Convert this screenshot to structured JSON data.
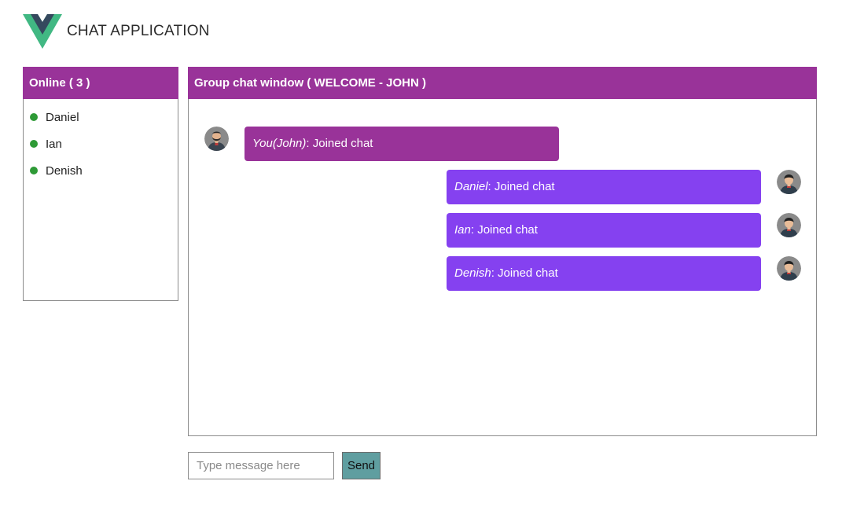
{
  "header": {
    "logo_icon": "vue-logo",
    "title": "CHAT APPLICATION"
  },
  "online": {
    "title": "Online ( 3 )",
    "status_color": "#2e9a36",
    "users": [
      {
        "name": "Daniel"
      },
      {
        "name": "Ian"
      },
      {
        "name": "Denish"
      }
    ]
  },
  "chat": {
    "title": "Group chat window ( WELCOME - JOHN )",
    "messages": [
      {
        "sender": "You(John)",
        "sep": ": ",
        "text": "Joined chat",
        "self": true,
        "avatar_icon": "bearded-man-avatar-icon"
      },
      {
        "sender": "Daniel",
        "sep": ": ",
        "text": "Joined chat",
        "self": false,
        "avatar_icon": "user-avatar-icon"
      },
      {
        "sender": "Ian",
        "sep": ": ",
        "text": "Joined chat",
        "self": false,
        "avatar_icon": "user-avatar-icon"
      },
      {
        "sender": "Denish",
        "sep": ": ",
        "text": "Joined chat",
        "self": false,
        "avatar_icon": "user-avatar-icon"
      }
    ]
  },
  "composer": {
    "placeholder": "Type message here",
    "value": "",
    "send_label": "Send"
  },
  "colors": {
    "header_bg": "#993399",
    "self_bubble": "#993399",
    "other_bubble": "#8541f0",
    "send_button": "#5f9ea0"
  }
}
